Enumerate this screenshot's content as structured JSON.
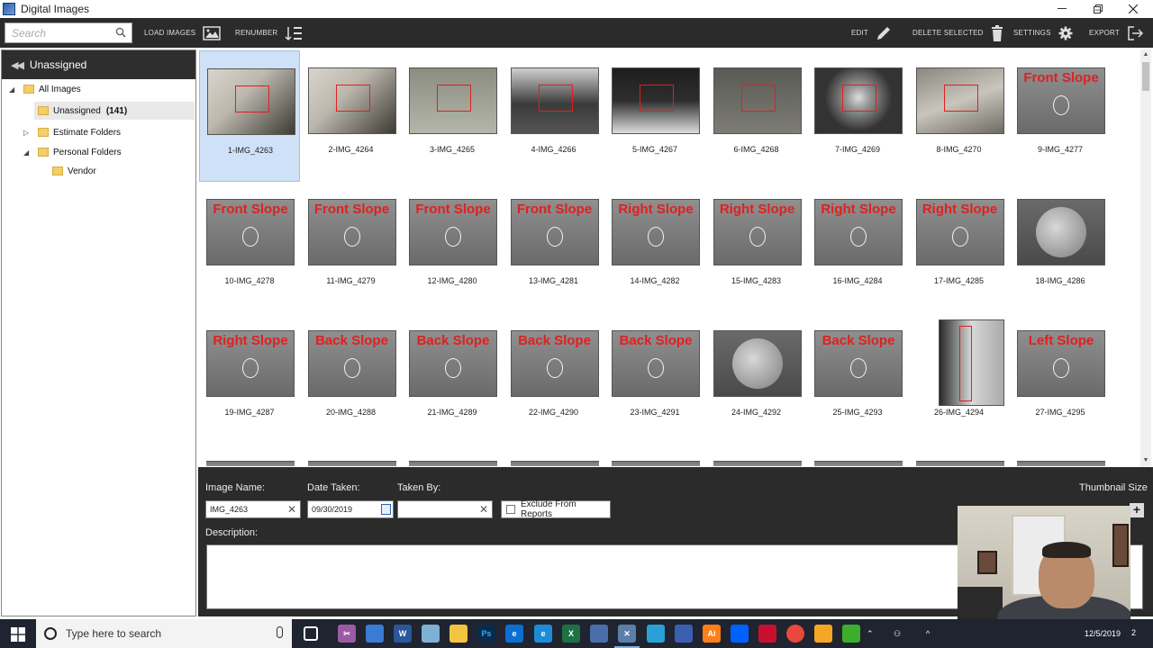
{
  "window": {
    "title": "Digital Images",
    "controls": {
      "minimize": "–",
      "restore": "❐",
      "close": "✕"
    }
  },
  "toolbar": {
    "search_placeholder": "Search",
    "load_images": "LOAD IMAGES",
    "renumber": "RENUMBER",
    "edit": "EDIT",
    "delete_selected": "DELETE SELECTED",
    "settings": "SETTINGS",
    "export": "EXPORT"
  },
  "sidebar": {
    "header": "Unassigned",
    "tree": {
      "all_images": "All Images",
      "unassigned": "Unassigned",
      "unassigned_count": "(141)",
      "estimate_folders": "Estimate Folders",
      "personal_folders": "Personal Folders",
      "vendor": "Vendor"
    }
  },
  "images": [
    {
      "caption": "1-IMG_4263",
      "kind": "measure",
      "selected": true
    },
    {
      "caption": "2-IMG_4264",
      "kind": "measure"
    },
    {
      "caption": "3-IMG_4265",
      "kind": "gutter"
    },
    {
      "caption": "4-IMG_4266",
      "kind": "shingle"
    },
    {
      "caption": "5-IMG_4267",
      "kind": "dark"
    },
    {
      "caption": "6-IMG_4268",
      "kind": "level"
    },
    {
      "caption": "7-IMG_4269",
      "kind": "gauge"
    },
    {
      "caption": "8-IMG_4270",
      "kind": "flashing"
    },
    {
      "caption": "9-IMG_4277",
      "kind": "label",
      "label": "Front Slope"
    },
    {
      "caption": "10-IMG_4278",
      "kind": "label",
      "label": "Front Slope"
    },
    {
      "caption": "11-IMG_4279",
      "kind": "label",
      "label": "Front Slope"
    },
    {
      "caption": "12-IMG_4280",
      "kind": "label",
      "label": "Front Slope"
    },
    {
      "caption": "13-IMG_4281",
      "kind": "label",
      "label": "Front Slope"
    },
    {
      "caption": "14-IMG_4282",
      "kind": "label",
      "label": "Right Slope"
    },
    {
      "caption": "15-IMG_4283",
      "kind": "label",
      "label": "Right Slope"
    },
    {
      "caption": "16-IMG_4284",
      "kind": "label",
      "label": "Right Slope"
    },
    {
      "caption": "17-IMG_4285",
      "kind": "label",
      "label": "Right Slope"
    },
    {
      "caption": "18-IMG_4286",
      "kind": "vent"
    },
    {
      "caption": "19-IMG_4287",
      "kind": "label",
      "label": "Right Slope"
    },
    {
      "caption": "20-IMG_4288",
      "kind": "label",
      "label": "Back Slope"
    },
    {
      "caption": "21-IMG_4289",
      "kind": "label",
      "label": "Back Slope"
    },
    {
      "caption": "22-IMG_4290",
      "kind": "label",
      "label": "Back Slope"
    },
    {
      "caption": "23-IMG_4291",
      "kind": "label",
      "label": "Back Slope"
    },
    {
      "caption": "24-IMG_4292",
      "kind": "vent"
    },
    {
      "caption": "25-IMG_4293",
      "kind": "label",
      "label": "Back Slope"
    },
    {
      "caption": "26-IMG_4294",
      "kind": "tall"
    },
    {
      "caption": "27-IMG_4295",
      "kind": "label",
      "label": "Left Slope"
    }
  ],
  "properties": {
    "image_name_label": "Image Name:",
    "image_name_value": "IMG_4263",
    "date_taken_label": "Date Taken:",
    "date_taken_value": "09/30/2019",
    "taken_by_label": "Taken By:",
    "taken_by_value": "",
    "exclude_label": "Exclude From Reports",
    "description_label": "Description:",
    "thumbnail_size_label": "Thumbnail Size"
  },
  "taskbar": {
    "search_placeholder": "Type here to search",
    "date": "12/5/2019",
    "notification_count": "2"
  },
  "colors": {
    "toolbar_bg": "#2b2b2b",
    "selection": "#cfe1f7",
    "annotation_red": "#e02020"
  }
}
